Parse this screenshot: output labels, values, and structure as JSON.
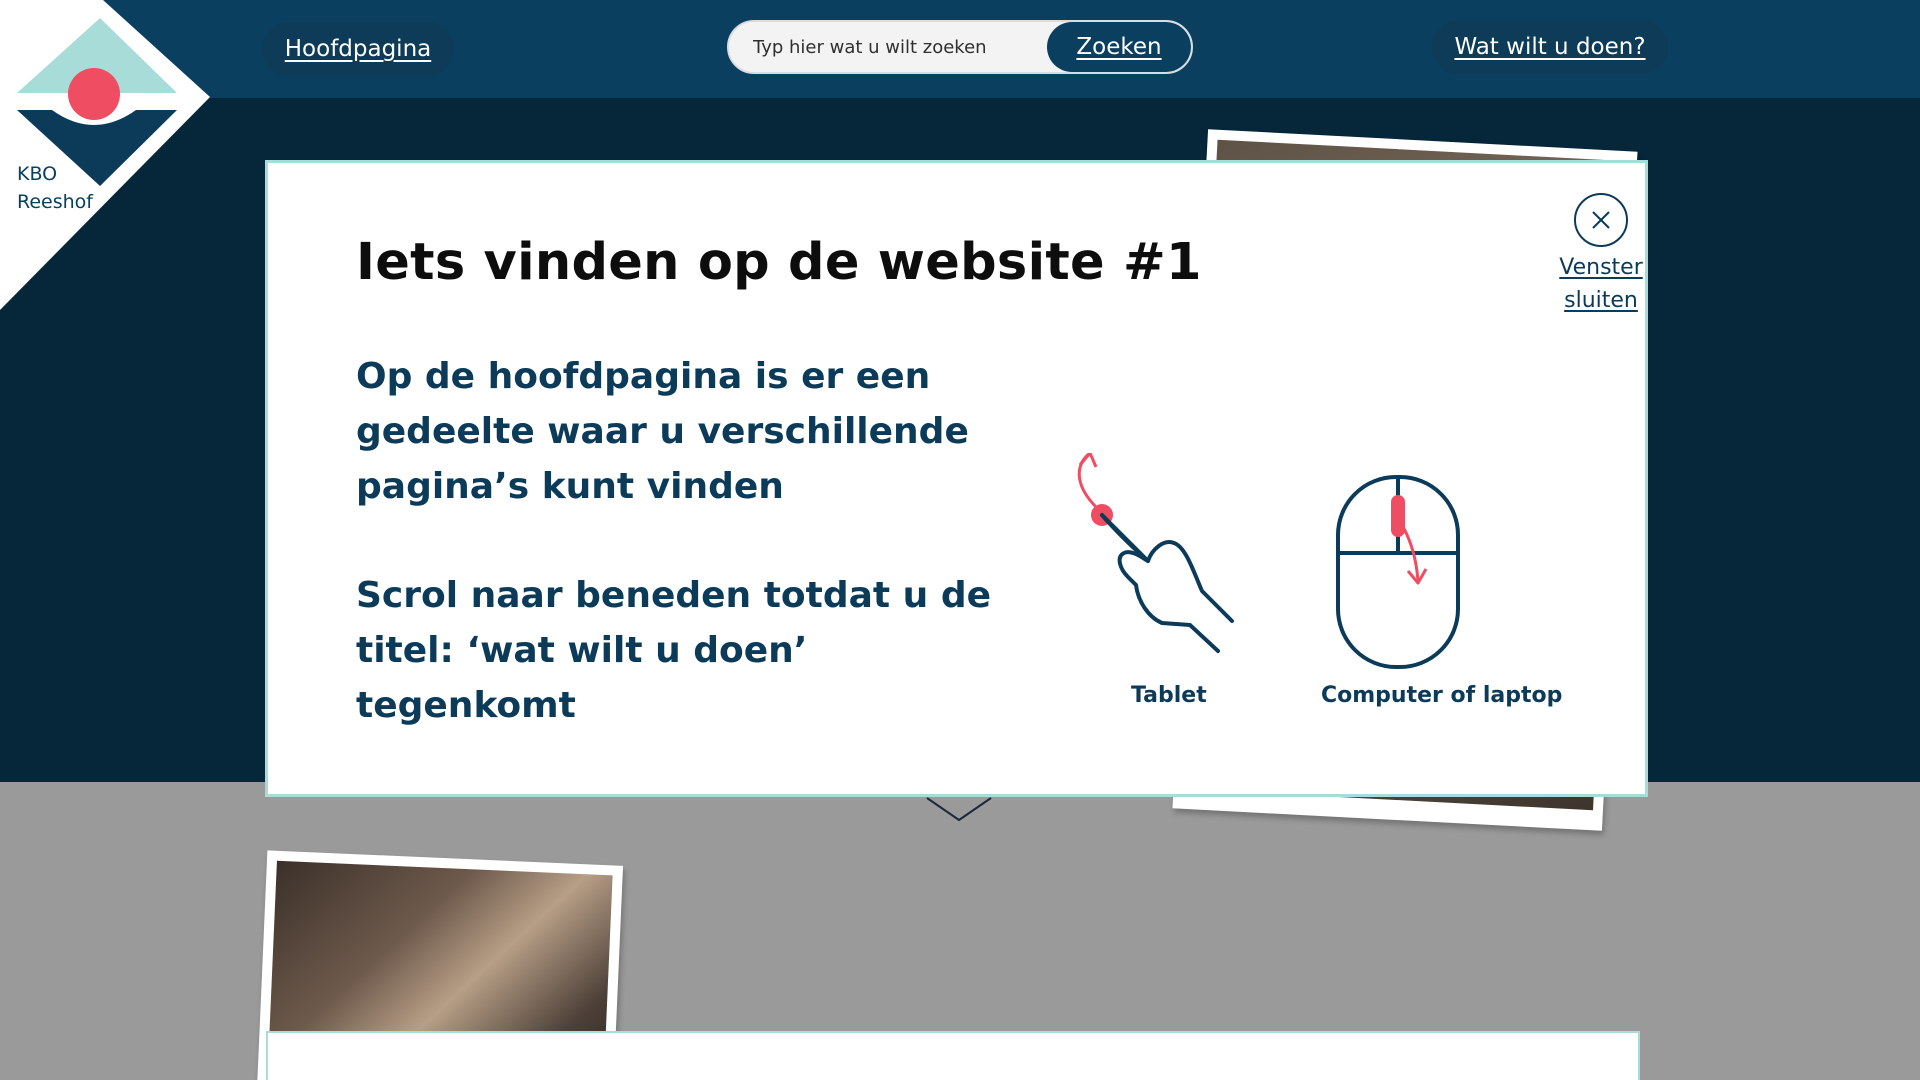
{
  "logo": {
    "line1": "KBO",
    "line2": "Reeshof"
  },
  "nav": {
    "home_label": "Hoofdpagina",
    "what_label": "Wat wilt u doen?"
  },
  "search": {
    "placeholder": "Typ hier wat u wilt zoeken",
    "button_label": "Zoeken"
  },
  "modal": {
    "title": "Iets vinden op de website #1",
    "text_1": "Op de hoofdpagina is er een gedeelte waar u verschillende pagina’s kunt vinden",
    "text_2": "Scrol naar beneden totdat u de titel: ‘wat wilt u doen’ tegenkomt",
    "close_label": "Venster sluiten",
    "illustrations": [
      {
        "icon": "tablet-swipe-icon",
        "label": "Tablet"
      },
      {
        "icon": "computer-mouse-scroll-icon",
        "label": "Computer of laptop"
      }
    ]
  },
  "colors": {
    "navy": "#0c3b5a",
    "header": "#0a3f60",
    "hero": "#06263a",
    "accent_red": "#ee4d62",
    "teal": "#a8dcd8"
  }
}
